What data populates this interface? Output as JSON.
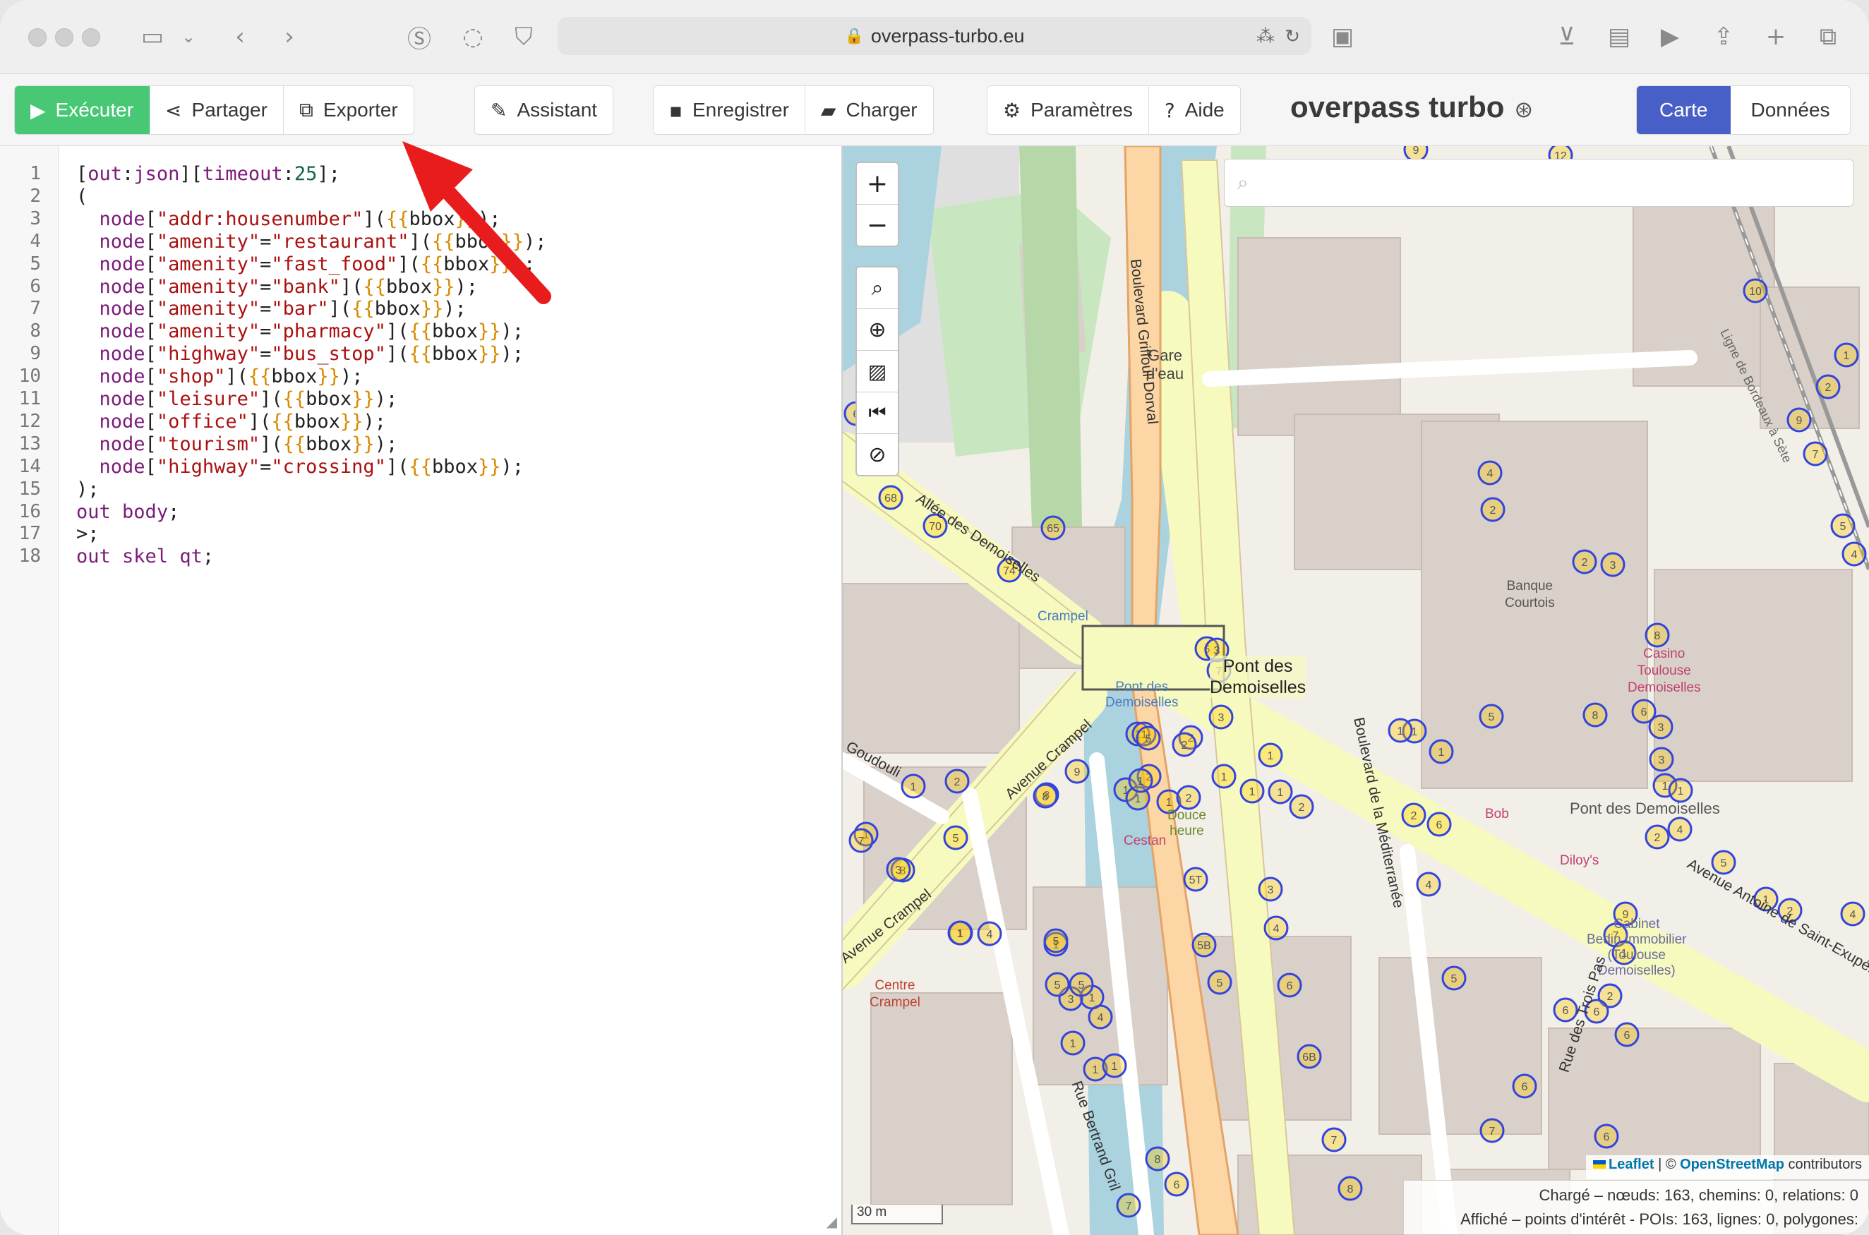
{
  "browser": {
    "url": "overpass-turbo.eu"
  },
  "toolbar": {
    "run_label": "Exécuter",
    "share_label": "Partager",
    "export_label": "Exporter",
    "wizard_label": "Assistant",
    "save_label": "Enregistrer",
    "load_label": "Charger",
    "settings_label": "Paramètres",
    "help_label": "Aide",
    "app_title": "overpass turbo",
    "map_tab_label": "Carte",
    "data_tab_label": "Données"
  },
  "editor": {
    "line_numbers": [
      "1",
      "2",
      "3",
      "4",
      "5",
      "6",
      "7",
      "8",
      "9",
      "10",
      "11",
      "12",
      "13",
      "14",
      "15",
      "16",
      "17",
      "18"
    ],
    "lines": [
      "[out:json][timeout:25];",
      "(",
      "  node[\"addr:housenumber\"]({{bbox}});",
      "  node[\"amenity\"=\"restaurant\"]({{bbox}});",
      "  node[\"amenity\"=\"fast_food\"]({{bbox}});",
      "  node[\"amenity\"=\"bank\"]({{bbox}});",
      "  node[\"amenity\"=\"bar\"]({{bbox}});",
      "  node[\"amenity\"=\"pharmacy\"]({{bbox}});",
      "  node[\"highway\"=\"bus_stop\"]({{bbox}});",
      "  node[\"shop\"]({{bbox}});",
      "  node[\"leisure\"]({{bbox}});",
      "  node[\"office\"]({{bbox}});",
      "  node[\"tourism\"]({{bbox}});",
      "  node[\"highway\"=\"crossing\"]({{bbox}});",
      ");",
      "out body;",
      ">;",
      "out skel qt;"
    ]
  },
  "map": {
    "zoom_in": "+",
    "zoom_out": "−",
    "labels": {
      "gare": "Gare\nd'eau",
      "pont": "Pont des\nDemoiselles",
      "banque": "Banque\nCourtois",
      "casino": "Casino\nToulouse\nDemoiselles",
      "crampel": "Crampel",
      "pont_stop": "Pont des\nDemoiselles",
      "douce": "Douce\nheure",
      "cestan": "Cestan",
      "bob": "Bob",
      "dilloys": "Diloy's",
      "centre": "Centre\nCrampel",
      "bedin": "Cabinet\nBedin Immobilier\n(Toulouse\nDemoiselles)",
      "pont2": "Pont des Demoiselles"
    },
    "streets": {
      "allee": "Allée des Demoiselles",
      "griffoul": "Boulevard Griffoul-Dorval",
      "medit": "Boulevard de la Méditerranée",
      "crampel": "Avenue Crampel",
      "crampel2": "Avenue Crampel",
      "antoine": "Avenue Antoine de Saint-Exupéry",
      "bertrand": "Rue Bertrand Gril",
      "goudouli": "Goudouli",
      "trois": "Rue des Trois Pas",
      "ligne": "Ligne de Bordeaux à Sète"
    },
    "scale": "30 m",
    "attribution": {
      "leaflet": "Leaflet",
      "sep": " | © ",
      "osm": "OpenStreetMap",
      "contrib": " contributors"
    },
    "stats": {
      "loaded": "Chargé – nœuds: 163, chemins: 0, relations: 0",
      "shown": "Affiché – points d'intérêt - POIs: 163, lignes: 0, polygones:"
    },
    "markers": [
      [
        "9",
        2006,
        212
      ],
      [
        "12",
        2211,
        220
      ],
      [
        "10",
        2487,
        412
      ],
      [
        "1",
        2616,
        503
      ],
      [
        "2",
        2590,
        548
      ],
      [
        "9",
        2549,
        595
      ],
      [
        "7",
        2572,
        643
      ],
      [
        "4",
        2111,
        670
      ],
      [
        "2",
        2115,
        722
      ],
      [
        "5",
        2611,
        745
      ],
      [
        "4",
        2627,
        785
      ],
      [
        "68",
        1262,
        705
      ],
      [
        "70",
        1325,
        745
      ],
      [
        "65",
        1492,
        748
      ],
      [
        "74",
        1430,
        808
      ],
      [
        "6",
        1213,
        586
      ],
      [
        "3",
        2285,
        800
      ],
      [
        "2",
        2245,
        796
      ],
      [
        "8",
        2348,
        900
      ],
      [
        "8",
        2260,
        1013
      ],
      [
        "6",
        2329,
        1008
      ],
      [
        "3",
        2353,
        1030
      ],
      [
        "3",
        2354,
        1076
      ],
      [
        "1",
        2359,
        1113
      ],
      [
        "1",
        2381,
        1120
      ],
      [
        "2",
        2348,
        1186
      ],
      [
        "4",
        2380,
        1175
      ],
      [
        "5",
        2442,
        1222
      ],
      [
        "1",
        2502,
        1274
      ],
      [
        "2",
        2536,
        1290
      ],
      [
        "4",
        2625,
        1295
      ],
      [
        "9",
        2303,
        1295
      ],
      [
        "7",
        2289,
        1325
      ],
      [
        "1",
        2301,
        1350
      ],
      [
        "2",
        2281,
        1411
      ],
      [
        "6",
        2262,
        1433
      ],
      [
        "6",
        2305,
        1466
      ],
      [
        "6",
        2218,
        1431
      ],
      [
        "6",
        2160,
        1539
      ],
      [
        "6",
        2276,
        1610
      ],
      [
        "7",
        2114,
        1602
      ],
      [
        "5",
        2060,
        1386
      ],
      [
        "4",
        2024,
        1253
      ],
      [
        "2",
        2003,
        1155
      ],
      [
        "6",
        2039,
        1168
      ],
      [
        "5",
        2113,
        1015
      ],
      [
        "1",
        2004,
        1036
      ],
      [
        "1",
        2042,
        1065
      ],
      [
        "1",
        1984,
        1035
      ],
      [
        "1",
        1774,
        1121
      ],
      [
        "1",
        1814,
        1122
      ],
      [
        "2",
        1844,
        1143
      ],
      [
        "3",
        1800,
        1260
      ],
      [
        "4",
        1808,
        1315
      ],
      [
        "5B",
        1706,
        1339
      ],
      [
        "6",
        1827,
        1396
      ],
      [
        "6B",
        1855,
        1497
      ],
      [
        "5",
        1728,
        1392
      ],
      [
        "5T",
        1694,
        1246
      ],
      [
        "7",
        1890,
        1615
      ],
      [
        "8",
        1913,
        1684
      ],
      [
        "8",
        1640,
        1642
      ],
      [
        "6",
        1667,
        1678
      ],
      [
        "7",
        1599,
        1708
      ],
      [
        "1",
        1552,
        1515
      ],
      [
        "1",
        1579,
        1510
      ],
      [
        "1",
        1520,
        1478
      ],
      [
        "4",
        1559,
        1441
      ],
      [
        "1",
        1547,
        1413
      ],
      [
        "3",
        1517,
        1415
      ],
      [
        "1",
        1496,
        1338
      ],
      [
        "5",
        1496,
        1333
      ],
      [
        "5",
        1498,
        1395
      ],
      [
        "5",
        1532,
        1395
      ],
      [
        "1",
        1361,
        1322
      ],
      [
        "1",
        1360,
        1322
      ],
      [
        "4",
        1402,
        1323
      ],
      [
        "1",
        1294,
        1114
      ],
      [
        "2",
        1356,
        1107
      ],
      [
        "1",
        1227,
        1182
      ],
      [
        "7",
        1220,
        1191
      ],
      [
        "8",
        1279,
        1233
      ],
      [
        "3",
        1273,
        1232
      ],
      [
        "5",
        1354,
        1187
      ],
      [
        "8",
        1483,
        1126
      ],
      [
        "8",
        1481,
        1128
      ],
      [
        "9",
        1526,
        1093
      ],
      [
        "1",
        1595,
        1119
      ],
      [
        "1",
        1612,
        1131
      ],
      [
        "2",
        1628,
        1100
      ],
      [
        "1",
        1656,
        1136
      ],
      [
        "2",
        1684,
        1130
      ],
      [
        "1",
        1734,
        1100
      ],
      [
        "1",
        1800,
        1070
      ],
      [
        "2",
        1687,
        1045
      ],
      [
        "2",
        1678,
        1055
      ],
      [
        "1",
        1612,
        1040
      ],
      [
        "1",
        1621,
        1040
      ],
      [
        "3",
        1730,
        1016
      ],
      [
        "7",
        1727,
        950
      ],
      [
        "6",
        1710,
        919
      ],
      [
        "5",
        1627,
        1046
      ],
      [
        "1",
        1616,
        1106
      ],
      [
        "3",
        1724,
        921
      ]
    ]
  }
}
